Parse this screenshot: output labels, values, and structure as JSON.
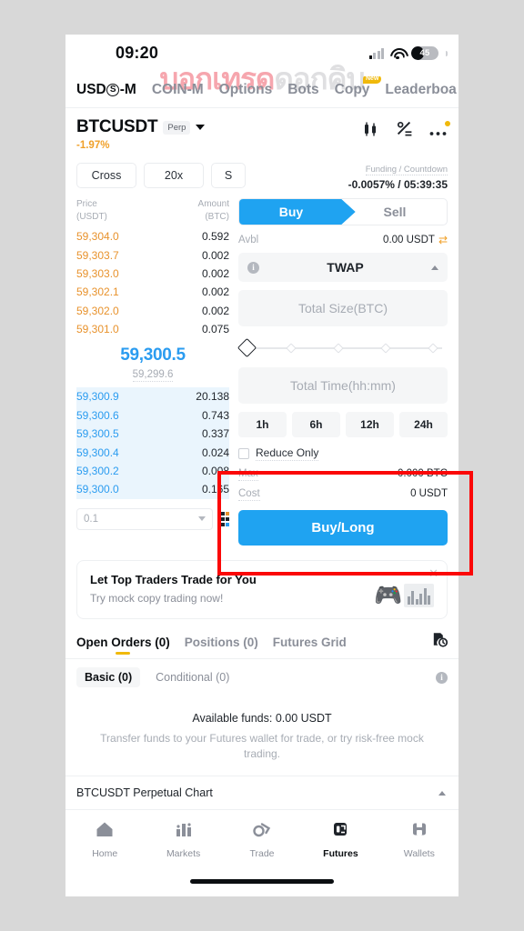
{
  "status_bar": {
    "time": "09:20",
    "battery_level": "45",
    "wifi_icon": "wifi-icon",
    "signal_icon": "signal-icon"
  },
  "watermark": {
    "part1": "บอกเทรด",
    "part2": "ดอกคิบ"
  },
  "top_tabs": [
    {
      "label": "USDⓈ-M",
      "active": true,
      "badge": ""
    },
    {
      "label": "COIN-M",
      "active": false,
      "badge": ""
    },
    {
      "label": "Options",
      "active": false,
      "badge": ""
    },
    {
      "label": "Bots",
      "active": false,
      "badge": ""
    },
    {
      "label": "Copy",
      "active": false,
      "badge": "New"
    },
    {
      "label": "Leaderboa",
      "active": false,
      "badge": ""
    }
  ],
  "symbol": {
    "name": "BTCUSDT",
    "tag": "Perp",
    "change": "-1.97%",
    "change_color": "#f0a029",
    "icons": [
      "candlestick-chart-icon",
      "calculator-icon",
      "more-options-icon"
    ]
  },
  "chips": [
    {
      "label": "Cross"
    },
    {
      "label": "20x"
    },
    {
      "label": "S"
    }
  ],
  "funding": {
    "label": "Funding / Countdown",
    "value": "-0.0057% / 05:39:35"
  },
  "orderbook": {
    "header": {
      "price": "Price",
      "price_unit": "(USDT)",
      "amount": "Amount",
      "amount_unit": "(BTC)"
    },
    "asks": [
      {
        "price": "59,304.0",
        "amount": "0.592"
      },
      {
        "price": "59,303.7",
        "amount": "0.002"
      },
      {
        "price": "59,303.0",
        "amount": "0.002"
      },
      {
        "price": "59,302.1",
        "amount": "0.002"
      },
      {
        "price": "59,302.0",
        "amount": "0.002"
      },
      {
        "price": "59,301.0",
        "amount": "0.075"
      }
    ],
    "mid_price": "59,300.5",
    "mark_price": "59,299.6",
    "bids": [
      {
        "price": "59,300.9",
        "amount": "20.138"
      },
      {
        "price": "59,300.6",
        "amount": "0.743"
      },
      {
        "price": "59,300.5",
        "amount": "0.337"
      },
      {
        "price": "59,300.4",
        "amount": "0.024"
      },
      {
        "price": "59,300.2",
        "amount": "0.008"
      },
      {
        "price": "59,300.0",
        "amount": "0.165"
      }
    ],
    "tick_value": "0.1",
    "ask_color": "#e8922c",
    "bid_color": "#2b9cf0",
    "depth_view_icon": "orderbook-layout-icon"
  },
  "order_form": {
    "buy_tab": "Buy",
    "sell_tab": "Sell",
    "avbl_label": "Avbl",
    "avbl_value": "0.00 USDT",
    "transfer_icon": "transfer-icon",
    "info_icon": "info-icon",
    "order_type": "TWAP",
    "collapse_icon": "chevron-up-icon",
    "total_size_placeholder": "Total Size(BTC)",
    "total_time_placeholder": "Total Time(hh:mm)",
    "time_presets": [
      "1h",
      "6h",
      "12h",
      "24h"
    ],
    "reduce_only": "Reduce Only",
    "max_label": "Max",
    "max_value": "0.000 BTC",
    "cost_label": "Cost",
    "cost_value": "0 USDT",
    "submit_label": "Buy/Long",
    "accent_color": "#1fa3f1"
  },
  "promo": {
    "title": "Let Top Traders Trade for You",
    "subtitle": "Try mock copy trading now!",
    "close_icon": "close-icon",
    "gamepad_icon": "gamepad-icon",
    "bars_icon": "bar-chart-icon"
  },
  "orders_section": {
    "tabs": [
      {
        "label": "Open Orders (0)",
        "active": true
      },
      {
        "label": "Positions (0)",
        "active": false
      },
      {
        "label": "Futures Grid",
        "active": false
      }
    ],
    "history_icon": "order-history-icon",
    "subtabs": [
      {
        "label": "Basic (0)",
        "active": true
      },
      {
        "label": "Conditional (0)",
        "active": false
      }
    ],
    "sub_info_icon": "info-icon",
    "empty_title": "Available funds: 0.00 USDT",
    "empty_body": "Transfer funds to your Futures wallet for trade, or try risk-free mock trading."
  },
  "chart_bar": {
    "label": "BTCUSDT Perpetual  Chart",
    "collapse_icon": "chevron-up-icon"
  },
  "bottom_nav": [
    {
      "label": "Home",
      "icon": "home-icon",
      "active": false
    },
    {
      "label": "Markets",
      "icon": "markets-icon",
      "active": false
    },
    {
      "label": "Trade",
      "icon": "trade-icon",
      "active": false
    },
    {
      "label": "Futures",
      "icon": "futures-icon",
      "active": true
    },
    {
      "label": "Wallets",
      "icon": "wallets-icon",
      "active": false
    }
  ],
  "annotation": {
    "type": "red-highlight-box"
  }
}
